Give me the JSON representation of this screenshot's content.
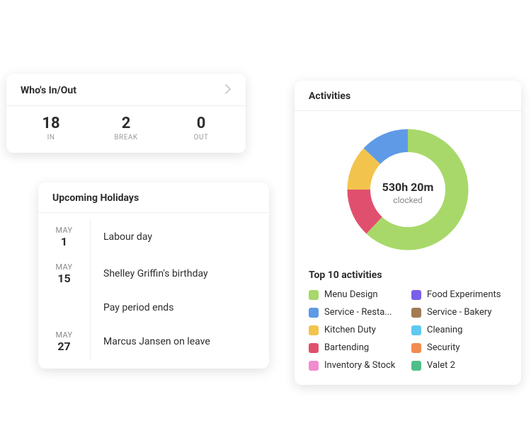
{
  "whos_in_out": {
    "title": "Who's In/Out",
    "stats": [
      {
        "value": "18",
        "label": "IN"
      },
      {
        "value": "2",
        "label": "BREAK"
      },
      {
        "value": "0",
        "label": "OUT"
      }
    ]
  },
  "activities": {
    "title": "Activities",
    "center_value": "530h 20m",
    "center_sub": "clocked",
    "top_title": "Top 10 activities",
    "legend": [
      {
        "label": "Menu Design",
        "color": "#a8d86a"
      },
      {
        "label": "Food Experiments",
        "color": "#7a5fe8"
      },
      {
        "label": "Service - Resta...",
        "color": "#5e9ae6"
      },
      {
        "label": "Service - Bakery",
        "color": "#a27b52"
      },
      {
        "label": "Kitchen Duty",
        "color": "#f2c44e"
      },
      {
        "label": "Cleaning",
        "color": "#5fc9ef"
      },
      {
        "label": "Bartending",
        "color": "#e0506e"
      },
      {
        "label": "Security",
        "color": "#f28b50"
      },
      {
        "label": "Inventory & Stock",
        "color": "#f08cd0"
      },
      {
        "label": "Valet 2",
        "color": "#4fbf8a"
      }
    ]
  },
  "upcoming_holidays": {
    "title": "Upcoming Holidays",
    "rows": [
      {
        "month": "MAY",
        "day": "1",
        "event": "Labour day"
      },
      {
        "month": "MAY",
        "day": "15",
        "event": "Shelley Griffin's birthday"
      },
      {
        "month": "",
        "day": "",
        "event": "Pay period ends"
      },
      {
        "month": "MAY",
        "day": "27",
        "event": "Marcus Jansen on leave"
      }
    ]
  },
  "chart_data": {
    "type": "pie",
    "title": "Activities",
    "series": [
      {
        "name": "Menu Design",
        "value": 62,
        "color": "#a8d86a"
      },
      {
        "name": "Bartending",
        "value": 13,
        "color": "#e0506e"
      },
      {
        "name": "Kitchen Duty",
        "value": 12,
        "color": "#f2c44e"
      },
      {
        "name": "Service - Resta...",
        "value": 13,
        "color": "#5e9ae6"
      }
    ],
    "center_value": "530h 20m",
    "center_sub": "clocked",
    "donut_inner_ratio": 0.62
  }
}
